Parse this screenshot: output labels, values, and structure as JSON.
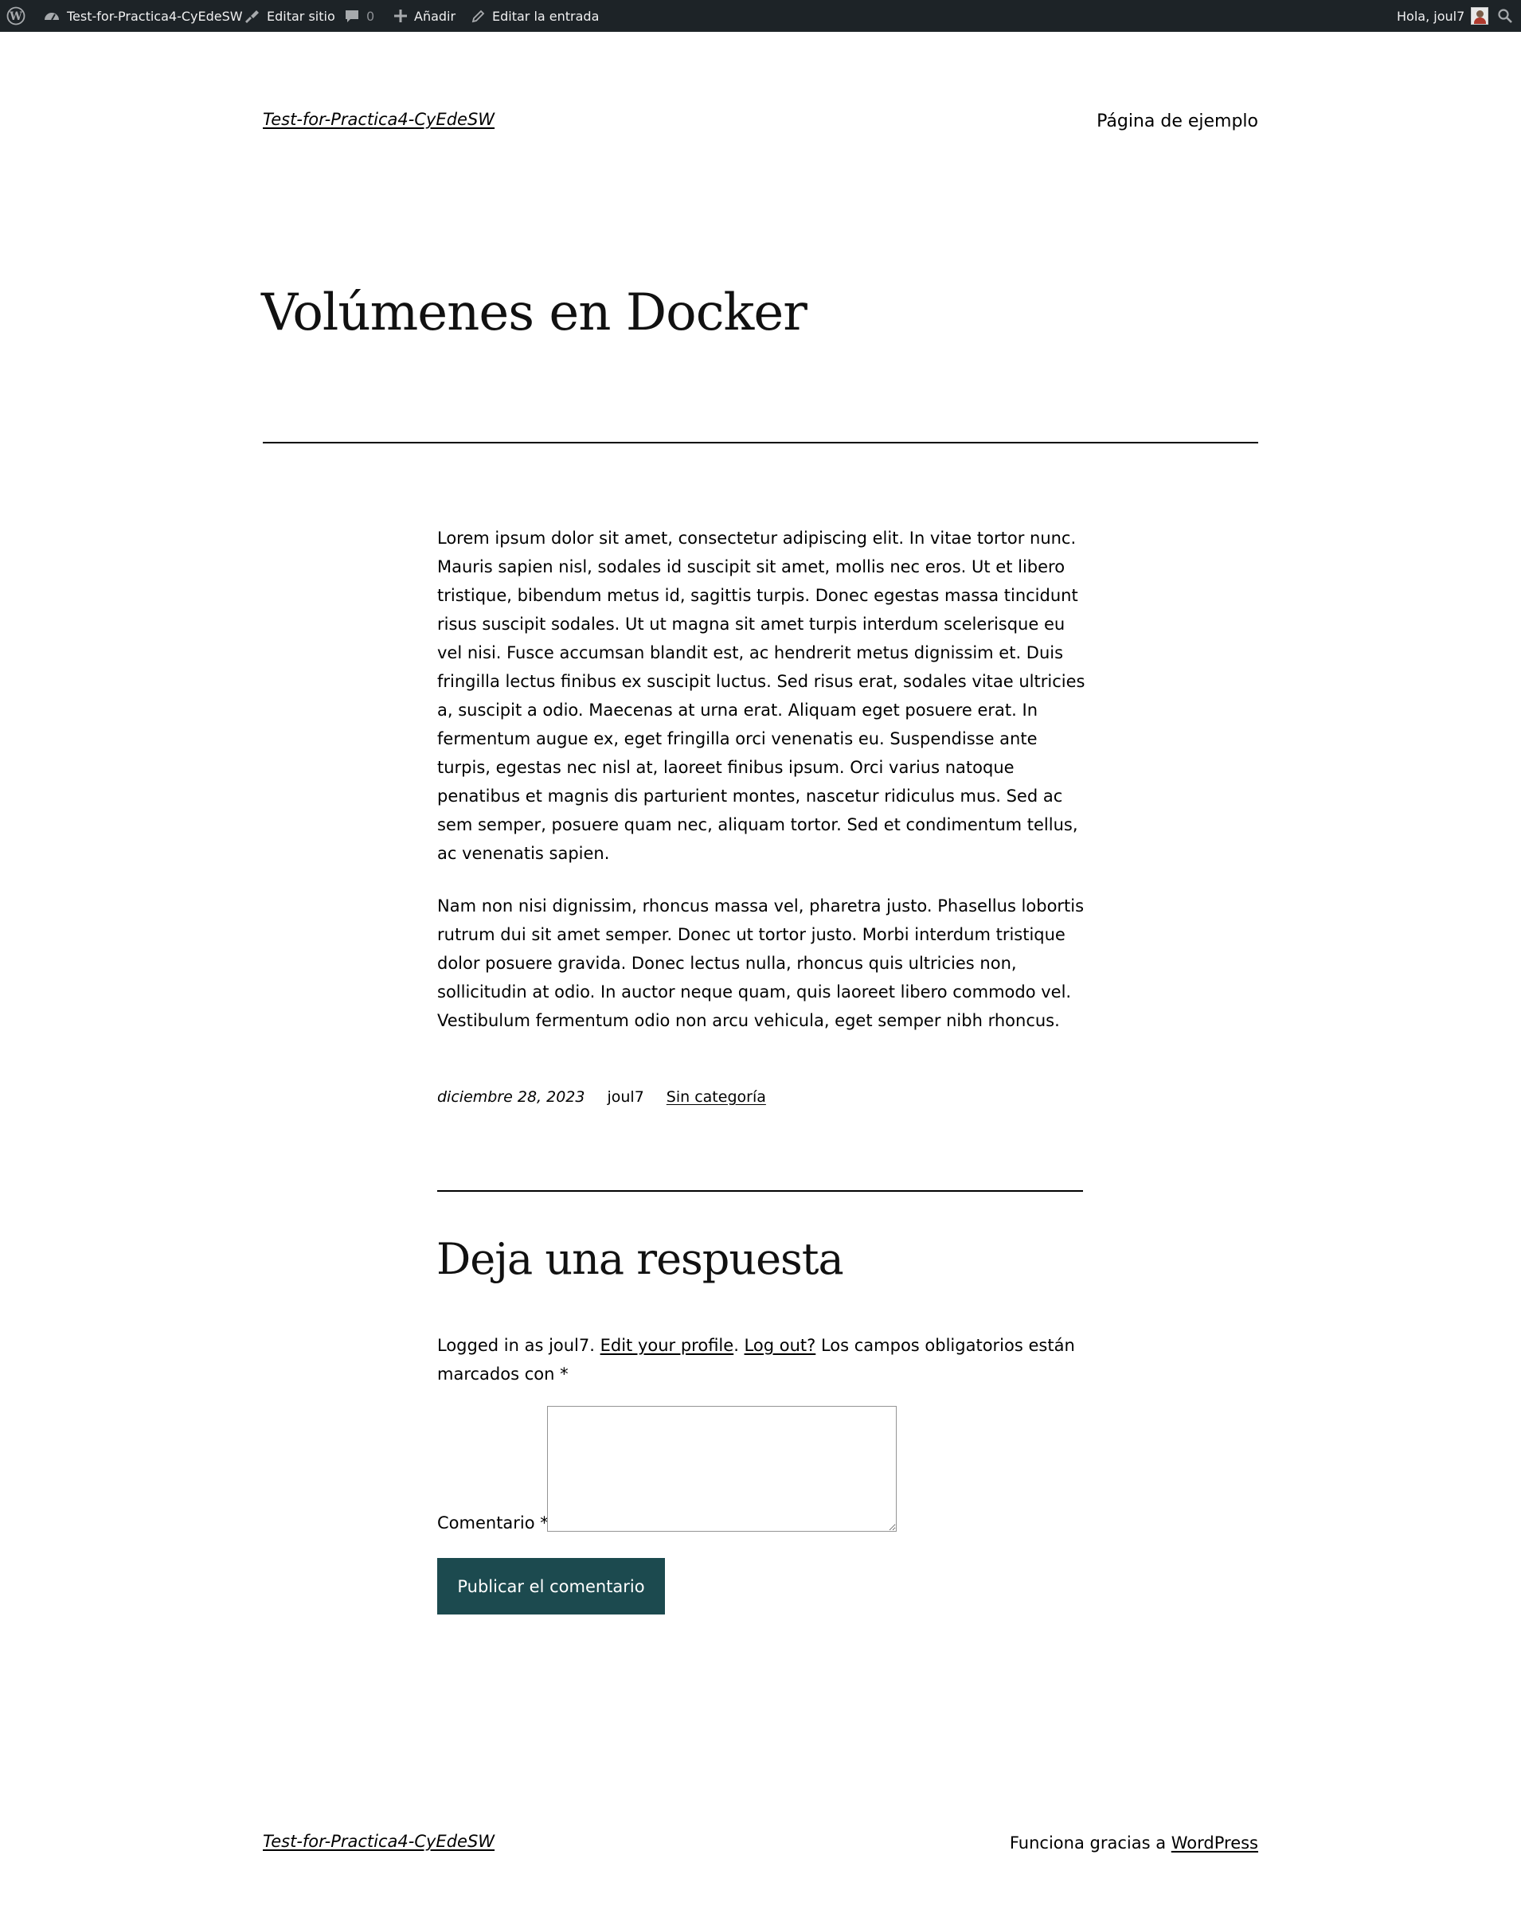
{
  "admin_bar": {
    "site_name": "Test-for-Practica4-CyEdeSW",
    "edit_site": "Editar sitio",
    "comments_count": "0",
    "add_new": "Añadir",
    "edit_post": "Editar la entrada",
    "greeting": "Hola, joul7",
    "icons": [
      "wordpress-logo-icon",
      "dashboard-icon",
      "brush-icon",
      "comment-icon",
      "plus-icon",
      "pencil-icon",
      "avatar",
      "search-icon"
    ],
    "colors": {
      "background": "#1d2327",
      "text": "#f0f0f1",
      "muted": "#8c8f94"
    }
  },
  "header": {
    "site_title": "Test-for-Practica4-CyEdeSW",
    "nav_link": "Página de ejemplo"
  },
  "post": {
    "title": "Volúmenes en Docker",
    "paragraphs": [
      "Lorem ipsum dolor sit amet, consectetur adipiscing elit. In vitae tortor nunc. Mauris sapien nisl, sodales id suscipit sit amet, mollis nec eros. Ut et libero tristique, bibendum metus id, sagittis turpis. Donec egestas massa tincidunt risus suscipit sodales. Ut ut magna sit amet turpis interdum scelerisque eu vel nisi. Fusce accumsan blandit est, ac hendrerit metus dignissim et. Duis fringilla lectus finibus ex suscipit luctus. Sed risus erat, sodales vitae ultricies a, suscipit a odio. Maecenas at urna erat. Aliquam eget posuere erat. In fermentum augue ex, eget fringilla orci venenatis eu. Suspendisse ante turpis, egestas nec nisl at, laoreet finibus ipsum. Orci varius natoque penatibus et magnis dis parturient montes, nascetur ridiculus mus. Sed ac sem semper, posuere quam nec, aliquam tortor. Sed et condimentum tellus, ac venenatis sapien.",
      "Nam non nisi dignissim, rhoncus massa vel, pharetra justo. Phasellus lobortis rutrum dui sit amet semper. Donec ut tortor justo. Morbi interdum tristique dolor posuere gravida. Donec lectus nulla, rhoncus quis ultricies non, sollicitudin at odio. In auctor neque quam, quis laoreet libero commodo vel. Vestibulum fermentum odio non arcu vehicula, eget semper nibh rhoncus."
    ],
    "date": "diciembre 28, 2023",
    "author": "joul7",
    "category": "Sin categoría"
  },
  "comments": {
    "title": "Deja una respuesta",
    "logged_in_prefix": "Logged in as joul7. ",
    "edit_profile": "Edit your profile",
    "period": ". ",
    "log_out": "Log out?",
    "required_note": " Los campos obligatorios están marcados con *",
    "comment_label": "Comentario *",
    "comment_value": "",
    "submit_label": "Publicar el comentario",
    "button_color": "#1c4a4f"
  },
  "footer": {
    "site_title": "Test-for-Practica4-CyEdeSW",
    "credit_prefix": "Funciona gracias a ",
    "credit_link": "WordPress"
  }
}
